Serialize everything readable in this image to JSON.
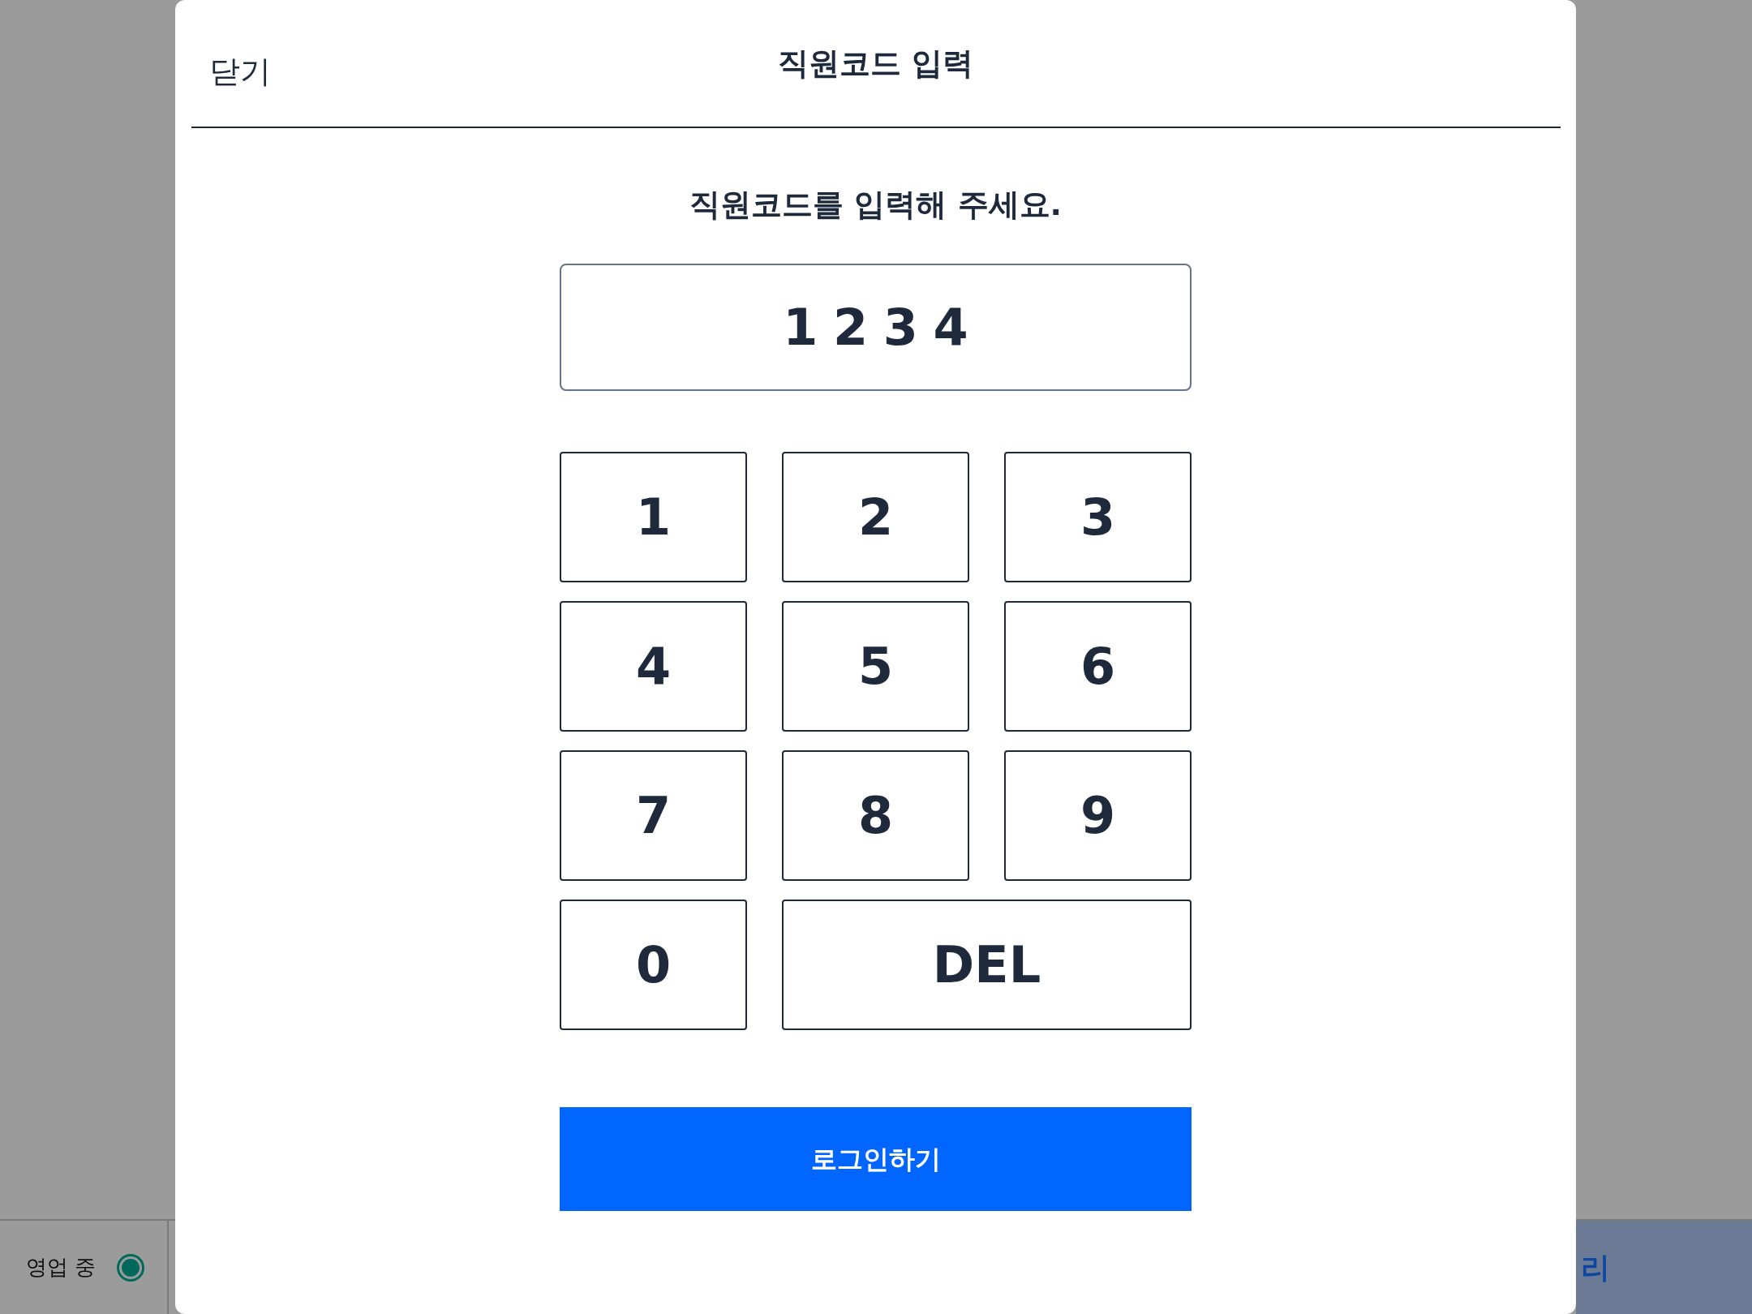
{
  "dialog": {
    "close_label": "닫기",
    "title": "직원코드 입력",
    "prompt": "직원코드를 입력해 주세요.",
    "code_value": "1234",
    "keys": [
      {
        "label": "1",
        "kind": "digit"
      },
      {
        "label": "2",
        "kind": "digit"
      },
      {
        "label": "3",
        "kind": "digit"
      },
      {
        "label": "4",
        "kind": "digit"
      },
      {
        "label": "5",
        "kind": "digit"
      },
      {
        "label": "6",
        "kind": "digit"
      },
      {
        "label": "7",
        "kind": "digit"
      },
      {
        "label": "8",
        "kind": "digit"
      },
      {
        "label": "9",
        "kind": "digit"
      },
      {
        "label": "0",
        "kind": "digit"
      },
      {
        "label": "DEL",
        "kind": "delete"
      }
    ],
    "login_button": "로그인하기"
  },
  "status_bar": {
    "status_label": "영업 중",
    "open": true,
    "right_button_text": "리"
  }
}
